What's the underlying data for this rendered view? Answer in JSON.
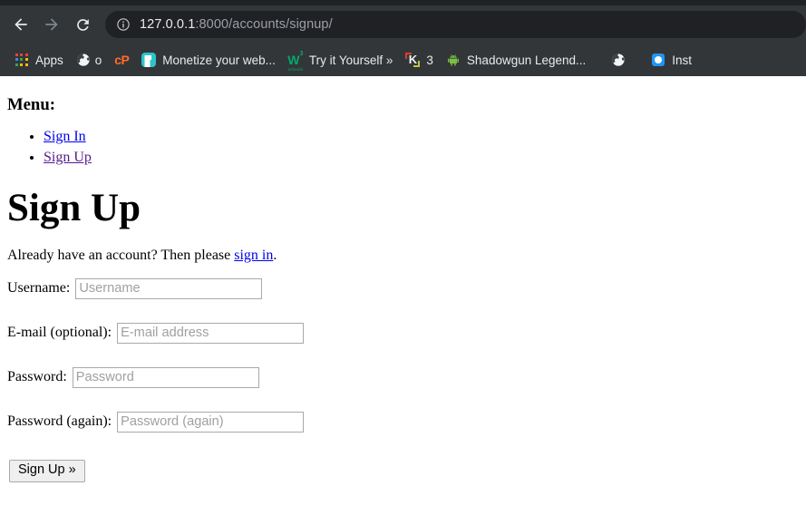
{
  "browser": {
    "nav": {
      "back_icon": "arrow-left-icon",
      "forward_icon": "arrow-right-icon",
      "reload_icon": "reload-icon"
    },
    "omnibox": {
      "site_info_icon": "info-circle-icon",
      "url_host": "127.0.0.1",
      "url_rest": ":8000/accounts/signup/",
      "full_url": "127.0.0.1:8000/accounts/signup/"
    },
    "bookmarks": [
      {
        "label": "Apps",
        "icon": "apps-grid-icon"
      },
      {
        "label": "o",
        "icon": "globe-icon"
      },
      {
        "label": "",
        "icon": "cpanel-icon"
      },
      {
        "label": "Monetize your web...",
        "icon": "teal-flag-icon"
      },
      {
        "label": "Try it Yourself »",
        "icon": "w3schools-icon"
      },
      {
        "label": "3",
        "icon": "k-bracket-icon"
      },
      {
        "label": "Shadowgun Legend...",
        "icon": "android-icon"
      },
      {
        "label": "",
        "icon": "globe-icon"
      },
      {
        "label": "Inst",
        "icon": "blue-square-icon"
      }
    ],
    "colors": {
      "toolbar_bg": "#323639",
      "omnibox_bg": "#202124",
      "text": "#e8eaed",
      "muted_text": "#9aa0a6"
    }
  },
  "page": {
    "menu_heading": "Menu:",
    "menu_items": [
      {
        "label": "Sign In",
        "state": "unvisited"
      },
      {
        "label": "Sign Up",
        "state": "visited"
      }
    ],
    "title": "Sign Up",
    "intro_prefix": "Already have an account? Then please ",
    "intro_link": "sign in",
    "intro_suffix": ".",
    "form": {
      "fields": [
        {
          "label": "Username:",
          "placeholder": "Username",
          "value": "",
          "type": "text"
        },
        {
          "label": "E-mail (optional):",
          "placeholder": "E-mail address",
          "value": "",
          "type": "text"
        },
        {
          "label": "Password:",
          "placeholder": "Password",
          "value": "",
          "type": "password"
        },
        {
          "label": "Password (again):",
          "placeholder": "Password (again)",
          "value": "",
          "type": "password"
        }
      ],
      "submit_label": "Sign Up »"
    },
    "colors": {
      "link_unvisited": "#0000ee",
      "link_visited": "#551a8b",
      "text": "#000000",
      "placeholder": "#a0a0a0"
    }
  }
}
